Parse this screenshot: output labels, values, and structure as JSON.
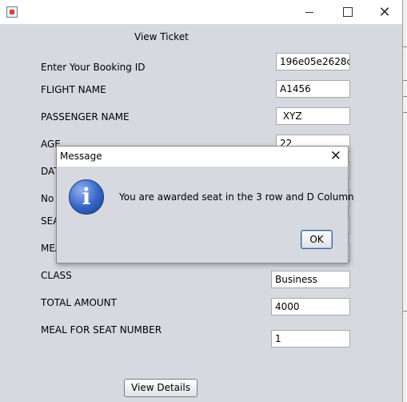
{
  "window": {
    "controls": {
      "minimize": "minimize",
      "maximize": "maximize",
      "close": "✕"
    }
  },
  "form": {
    "heading": "View Ticket",
    "fields": [
      {
        "label": "Enter Your Booking ID",
        "value": "196e05e2628c"
      },
      {
        "label": "FLIGHT NAME",
        "value": "A1456"
      },
      {
        "label": "PASSENGER NAME",
        "value": " XYZ"
      },
      {
        "label": "AGE",
        "value": "22"
      },
      {
        "label": "DAT",
        "value": ""
      },
      {
        "label": "No",
        "value": ""
      },
      {
        "label": "SEA",
        "value": ""
      },
      {
        "label": "MEA",
        "value": ""
      },
      {
        "label": "CLASS",
        "value": "Business"
      },
      {
        "label": "TOTAL AMOUNT",
        "value": "4000"
      },
      {
        "label": "MEAL FOR SEAT NUMBER",
        "value": "1"
      }
    ],
    "view_button": "View Details"
  },
  "dialog": {
    "title": "Message",
    "close": "✕",
    "icon": "info-icon",
    "icon_glyph": "i",
    "message": "You are awarded seat in the 3 row and D Column",
    "ok_label": "OK"
  },
  "colors": {
    "panel": "#d6d9df",
    "info_blue": "#3563c4",
    "ok_border": "#3c5f94"
  }
}
